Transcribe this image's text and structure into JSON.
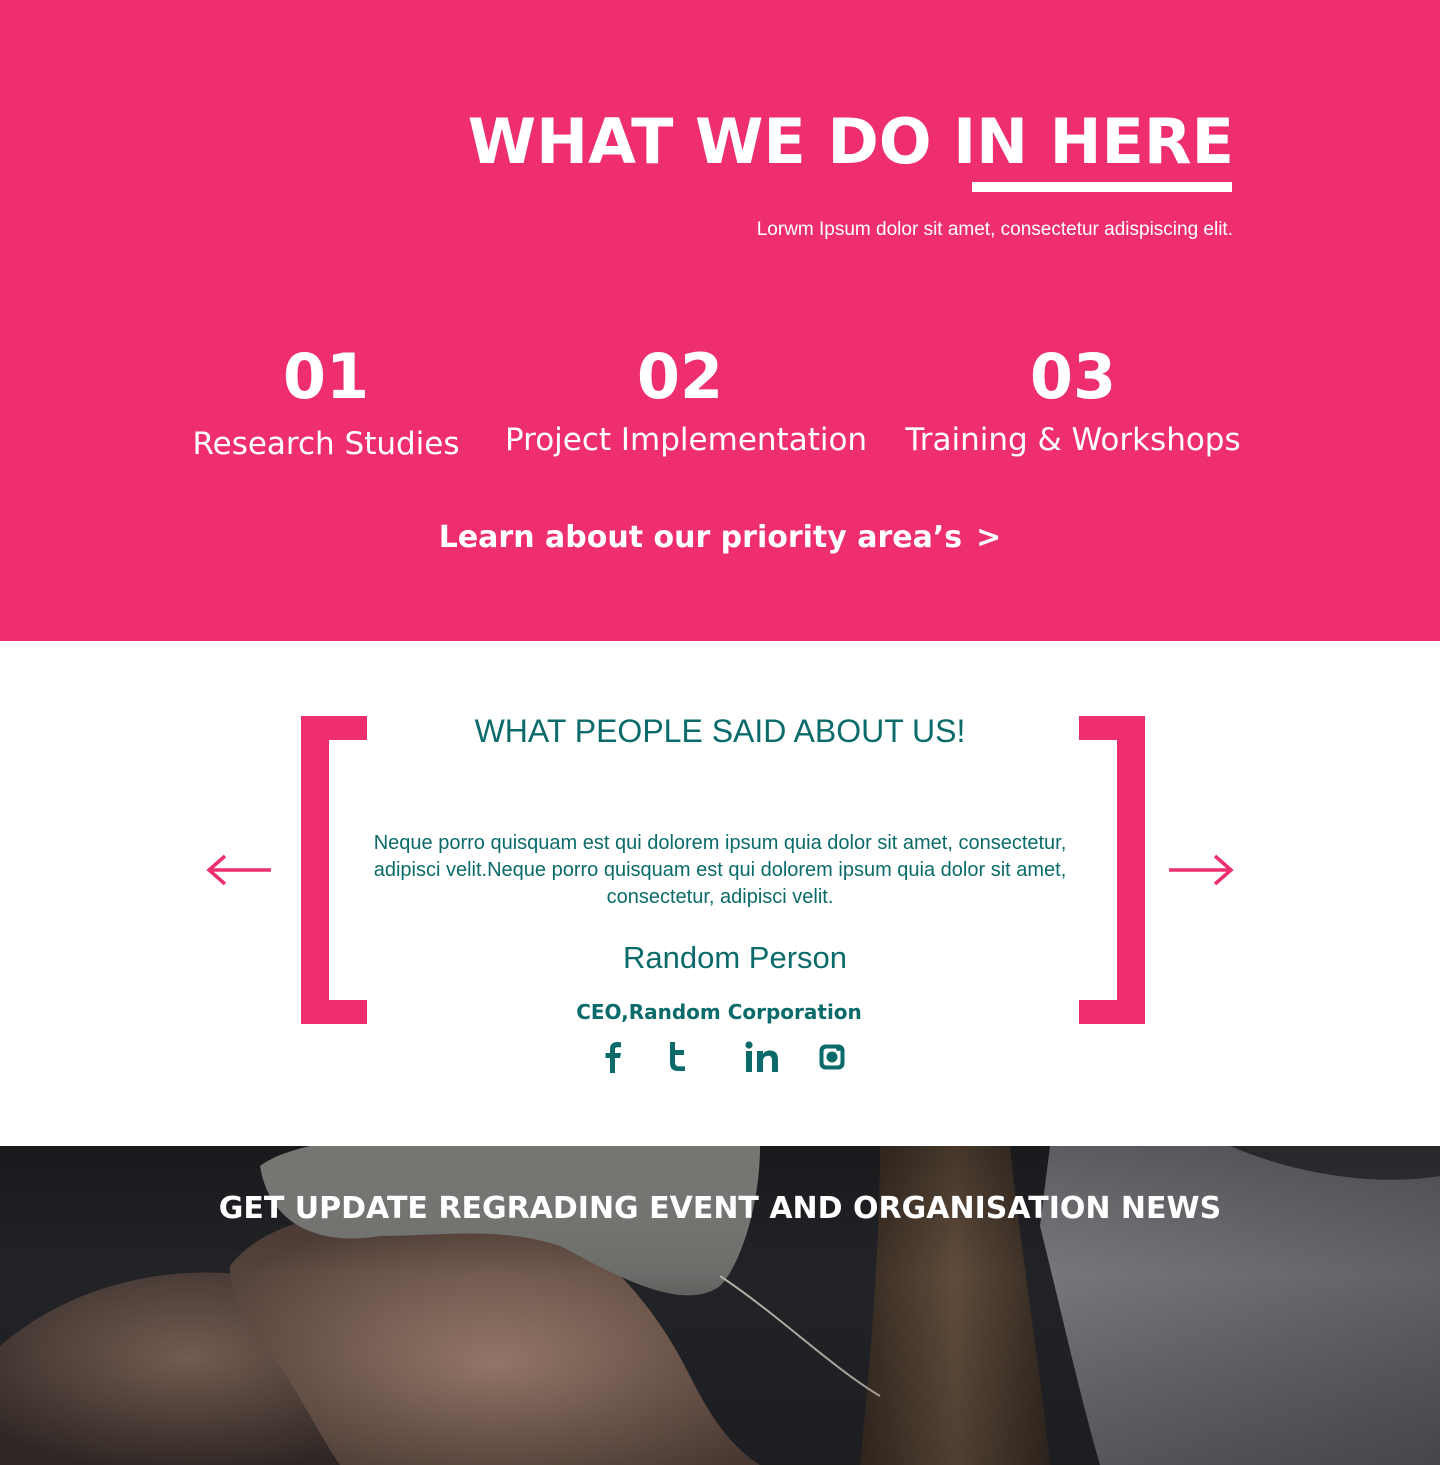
{
  "hero": {
    "title_part1": "WHAT WE DO ",
    "title_part2": "IN HERE",
    "subtitle": "Lorwm Ipsum dolor sit amet, consectetur adispiscing elit.",
    "services": [
      {
        "number": "01",
        "name": "Research Studies"
      },
      {
        "number": "02",
        "name": "Project Implementation"
      },
      {
        "number": "03",
        "name": "Training & Workshops"
      }
    ],
    "learn_link": "Learn about our priority area’s",
    "learn_link_chevron": ">",
    "colors": {
      "background": "#ef2e72",
      "text": "#ffffff"
    }
  },
  "testimonial": {
    "heading": "WHAT PEOPLE SAID ABOUT US!",
    "quote": "Neque porro quisquam est qui dolorem ipsum quia dolor sit amet, consectetur, adipisci velit.Neque porro quisquam est qui dolorem ipsum quia dolor sit amet, consectetur, adipisci velit.",
    "name": "Random Person",
    "role": "CEO,Random Corporation",
    "prev_icon": "arrow-left-icon",
    "next_icon": "arrow-right-icon",
    "social_icons": [
      "facebook-icon",
      "twitter-icon",
      "linkedin-icon",
      "instagram-icon"
    ],
    "colors": {
      "text": "#0b6b6b",
      "accent": "#ef2e72"
    }
  },
  "news": {
    "heading": "GET UPDATE REGRADING EVENT AND ORGANISATION NEWS"
  }
}
